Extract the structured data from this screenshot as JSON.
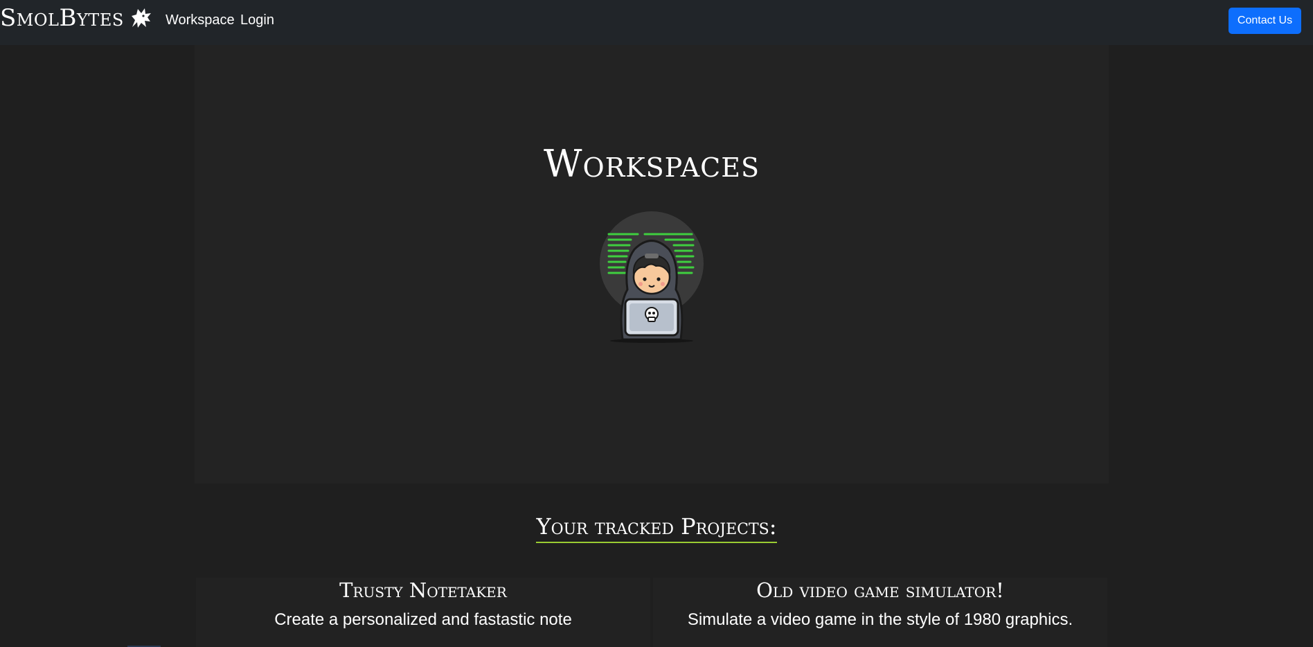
{
  "navbar": {
    "brand": "SmolBytes",
    "brand_icon": "wolf-head-icon",
    "links": [
      "Workspace",
      "Login"
    ],
    "contact_label": "Contact Us",
    "accent": "#0d6efd"
  },
  "hero": {
    "title": "Workspaces",
    "illustration": "hacker-with-laptop-icon"
  },
  "projects": {
    "heading": "Your tracked Projects:",
    "underline_color": "#9acd32",
    "items": [
      {
        "title": "Trusty Notetaker",
        "description": "Create a personalized and fastastic note"
      },
      {
        "title": "Old video game simulator!",
        "description": "Simulate a video game in the style of 1980 graphics."
      }
    ]
  }
}
